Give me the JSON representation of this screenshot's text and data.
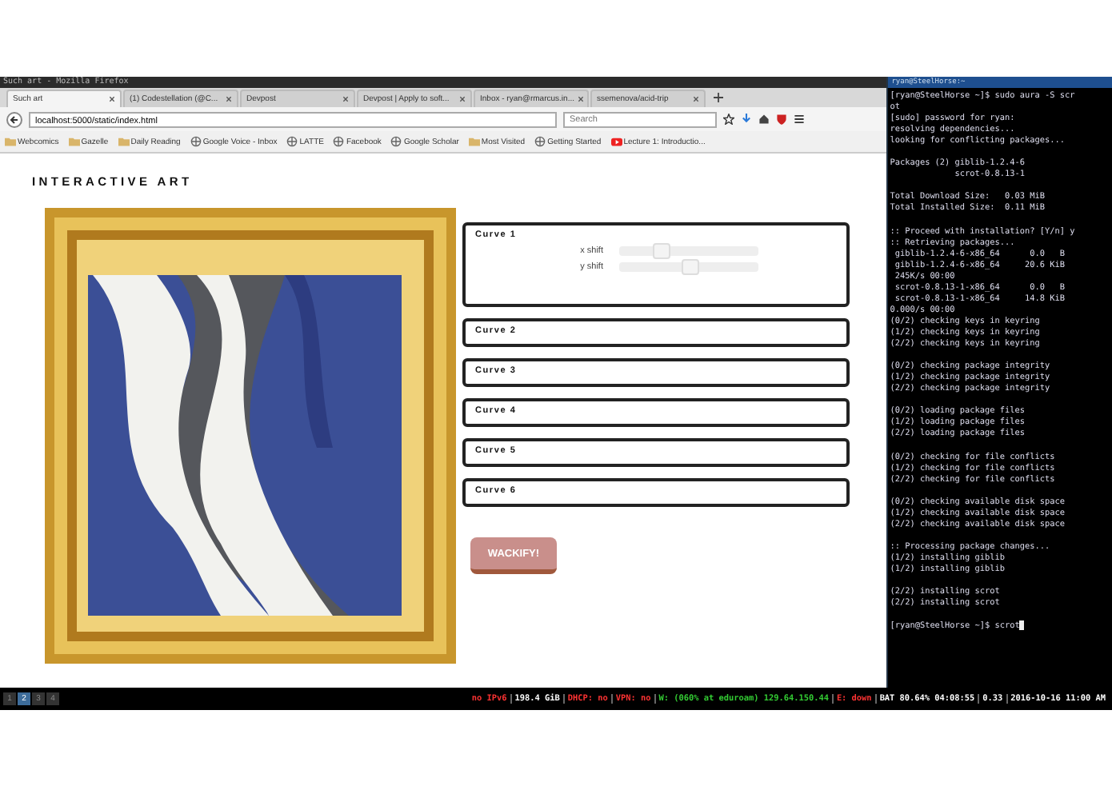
{
  "window": {
    "title": "Such art - Mozilla Firefox"
  },
  "tabs": [
    {
      "label": "Such art",
      "selected": true
    },
    {
      "label": "(1) Codestellation (@C...",
      "selected": false
    },
    {
      "label": "Devpost",
      "selected": false
    },
    {
      "label": "Devpost | Apply to soft...",
      "selected": false
    },
    {
      "label": "Inbox - ryan@rmarcus.in...",
      "selected": false
    },
    {
      "label": "ssemenova/acid-trip",
      "selected": false
    }
  ],
  "address_bar": {
    "value": "localhost:5000/static/index.html"
  },
  "search": {
    "placeholder": "Search"
  },
  "bookmarks": [
    {
      "label": "Webcomics",
      "kind": "folder"
    },
    {
      "label": "Gazelle",
      "kind": "folder"
    },
    {
      "label": "Daily Reading",
      "kind": "folder"
    },
    {
      "label": "Google Voice - Inbox",
      "kind": "page"
    },
    {
      "label": "LATTE",
      "kind": "page"
    },
    {
      "label": "Facebook",
      "kind": "page"
    },
    {
      "label": "Google Scholar",
      "kind": "page"
    },
    {
      "label": "Most Visited",
      "kind": "folder"
    },
    {
      "label": "Getting Started",
      "kind": "page"
    },
    {
      "label": "Lecture 1: Introductio...",
      "kind": "video"
    }
  ],
  "page": {
    "heading": "INTERACTIVE ART",
    "curves": [
      {
        "label": "Curve 1",
        "expanded": true,
        "sliders": [
          {
            "label": "x shift",
            "level": 0.3
          },
          {
            "label": "y shift",
            "level": 0.5
          }
        ]
      },
      {
        "label": "Curve 2",
        "expanded": false
      },
      {
        "label": "Curve 3",
        "expanded": false
      },
      {
        "label": "Curve 4",
        "expanded": false
      },
      {
        "label": "Curve 5",
        "expanded": false
      },
      {
        "label": "Curve 6",
        "expanded": false
      }
    ],
    "button": "WACKIFY!"
  },
  "terminal": {
    "title": "ryan@SteelHorse:~",
    "blocks": [
      [
        "[ryan@SteelHorse ~]$ sudo aura -S scr",
        "ot",
        "[sudo] password for ryan:",
        "resolving dependencies...",
        "looking for conflicting packages..."
      ],
      [
        "Packages (2) giblib-1.2.4-6",
        "             scrot-0.8.13-1"
      ],
      [
        "Total Download Size:   0.03 MiB",
        "Total Installed Size:  0.11 MiB"
      ],
      [
        ":: Proceed with installation? [Y/n] y",
        ":: Retrieving packages...",
        " giblib-1.2.4-6-x86_64      0.0   B",
        " giblib-1.2.4-6-x86_64     20.6 KiB",
        " 245K/s 00:00",
        " scrot-0.8.13-1-x86_64      0.0   B",
        " scrot-0.8.13-1-x86_64     14.8 KiB",
        "0.000/s 00:00",
        "(0/2) checking keys in keyring",
        "(1/2) checking keys in keyring",
        "(2/2) checking keys in keyring"
      ],
      [
        "(0/2) checking package integrity",
        "(1/2) checking package integrity",
        "(2/2) checking package integrity"
      ],
      [
        "(0/2) loading package files",
        "(1/2) loading package files",
        "(2/2) loading package files"
      ],
      [
        "(0/2) checking for file conflicts",
        "(1/2) checking for file conflicts",
        "(2/2) checking for file conflicts"
      ],
      [
        "(0/2) checking available disk space",
        "(1/2) checking available disk space",
        "(2/2) checking available disk space"
      ],
      [
        ":: Processing package changes...",
        "(1/2) installing giblib",
        "(1/2) installing giblib"
      ],
      [
        "(2/2) installing scrot",
        "(2/2) installing scrot"
      ],
      [
        "[ryan@SteelHorse ~]$ scrot"
      ]
    ]
  },
  "taskbar": {
    "workspaces": [
      {
        "label": "1",
        "selected": false
      },
      {
        "label": "2",
        "selected": true
      },
      {
        "label": "3",
        "selected": false
      },
      {
        "label": "4",
        "selected": false
      }
    ],
    "status": [
      {
        "text": "no IPv6",
        "color": "#ff3333"
      },
      {
        "text": "198.4 GiB",
        "color": "#ffffff"
      },
      {
        "text": "DHCP: no",
        "color": "#ff3333"
      },
      {
        "text": "VPN: no",
        "color": "#ff3333"
      },
      {
        "text": "W: (060% at eduroam) 129.64.150.44",
        "color": "#33cc33"
      },
      {
        "text": "E: down",
        "color": "#ff3333"
      },
      {
        "text": "BAT 80.64% 04:08:55",
        "color": "#ffffff"
      },
      {
        "text": "0.33",
        "color": "#ffffff"
      },
      {
        "text": "2016-10-16 11:00 AM",
        "color": "#ffffff"
      }
    ]
  }
}
